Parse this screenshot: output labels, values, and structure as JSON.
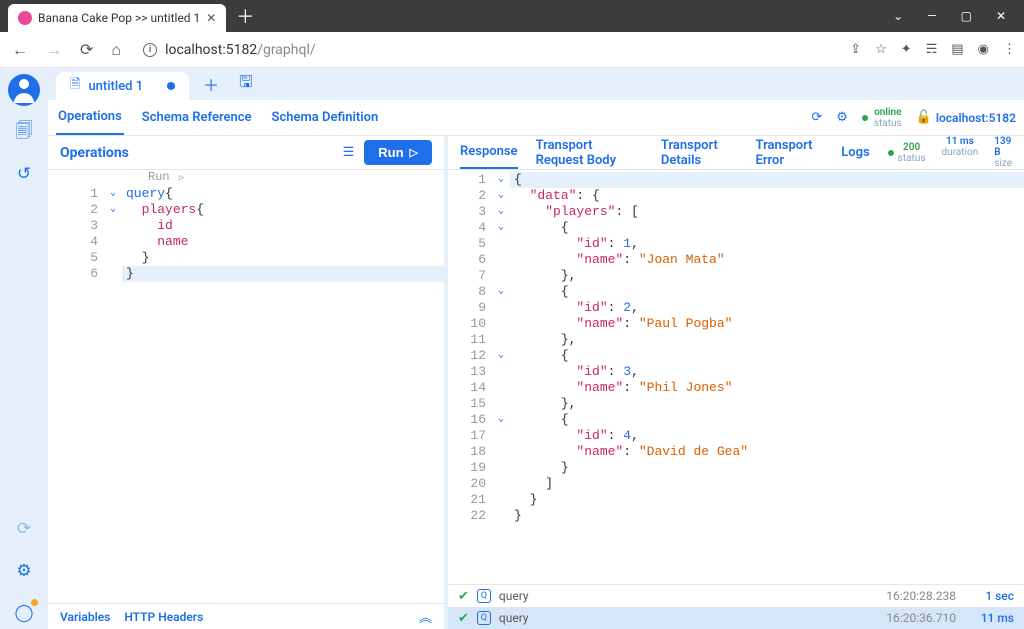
{
  "browser": {
    "tab_title": "Banana Cake Pop >> untitled 1",
    "url_host": "localhost:5182",
    "url_path": "/graphql/"
  },
  "doc_tabs": {
    "active": "untitled 1"
  },
  "tool_tabs": {
    "operations": "Operations",
    "schema_reference": "Schema Reference",
    "schema_definition": "Schema Definition"
  },
  "top_status": {
    "online_label": "online",
    "status_label": "status",
    "host": "localhost:5182"
  },
  "ops_panel": {
    "title": "Operations",
    "run_label": "Run",
    "codelens": "Run"
  },
  "query_lines": [
    {
      "n": 1,
      "fold": "v",
      "html": "<span class='tk-kw'>query</span><span class='tk-brace'>{</span>"
    },
    {
      "n": 2,
      "fold": "v",
      "html": "  <span class='tk-field'>players</span><span class='tk-brace'>{</span>"
    },
    {
      "n": 3,
      "fold": "",
      "html": "    <span class='tk-field'>id</span>"
    },
    {
      "n": 4,
      "fold": "",
      "html": "    <span class='tk-field'>name</span>"
    },
    {
      "n": 5,
      "fold": "",
      "html": "  <span class='tk-brace'>}</span>"
    },
    {
      "n": 6,
      "fold": "",
      "html": "<span class='tk-brace'>}</span>",
      "hl": true
    }
  ],
  "resp_tabs": {
    "response": "Response",
    "transport_request_body": "Transport Request Body",
    "transport_details": "Transport Details",
    "transport_error": "Transport Error",
    "logs": "Logs"
  },
  "resp_stats": {
    "status_value": "200",
    "status_label": "status",
    "duration_value": "11 ms",
    "duration_label": "duration",
    "size_value": "139 B",
    "size_label": "size"
  },
  "response_lines": [
    {
      "n": 1,
      "fold": "v",
      "html": "<span class='tk-punct'>{</span>",
      "hl": true
    },
    {
      "n": 2,
      "fold": "v",
      "html": "  <span class='tk-key'>\"data\"</span><span class='tk-punct'>: {</span>"
    },
    {
      "n": 3,
      "fold": "v",
      "html": "    <span class='tk-key'>\"players\"</span><span class='tk-punct'>: [</span>"
    },
    {
      "n": 4,
      "fold": "v",
      "html": "      <span class='tk-punct'>{</span>"
    },
    {
      "n": 5,
      "fold": "",
      "html": "        <span class='tk-key'>\"id\"</span><span class='tk-punct'>: </span><span class='tk-num'>1</span><span class='tk-punct'>,</span>"
    },
    {
      "n": 6,
      "fold": "",
      "html": "        <span class='tk-key'>\"name\"</span><span class='tk-punct'>: </span><span class='tk-str'>\"Joan Mata\"</span>"
    },
    {
      "n": 7,
      "fold": "",
      "html": "      <span class='tk-punct'>},</span>"
    },
    {
      "n": 8,
      "fold": "v",
      "html": "      <span class='tk-punct'>{</span>"
    },
    {
      "n": 9,
      "fold": "",
      "html": "        <span class='tk-key'>\"id\"</span><span class='tk-punct'>: </span><span class='tk-num'>2</span><span class='tk-punct'>,</span>"
    },
    {
      "n": 10,
      "fold": "",
      "html": "        <span class='tk-key'>\"name\"</span><span class='tk-punct'>: </span><span class='tk-str'>\"Paul Pogba\"</span>"
    },
    {
      "n": 11,
      "fold": "",
      "html": "      <span class='tk-punct'>},</span>"
    },
    {
      "n": 12,
      "fold": "v",
      "html": "      <span class='tk-punct'>{</span>"
    },
    {
      "n": 13,
      "fold": "",
      "html": "        <span class='tk-key'>\"id\"</span><span class='tk-punct'>: </span><span class='tk-num'>3</span><span class='tk-punct'>,</span>"
    },
    {
      "n": 14,
      "fold": "",
      "html": "        <span class='tk-key'>\"name\"</span><span class='tk-punct'>: </span><span class='tk-str'>\"Phil Jones\"</span>"
    },
    {
      "n": 15,
      "fold": "",
      "html": "      <span class='tk-punct'>},</span>"
    },
    {
      "n": 16,
      "fold": "v",
      "html": "      <span class='tk-punct'>{</span>"
    },
    {
      "n": 17,
      "fold": "",
      "html": "        <span class='tk-key'>\"id\"</span><span class='tk-punct'>: </span><span class='tk-num'>4</span><span class='tk-punct'>,</span>"
    },
    {
      "n": 18,
      "fold": "",
      "html": "        <span class='tk-key'>\"name\"</span><span class='tk-punct'>: </span><span class='tk-str'>\"David de Gea\"</span>"
    },
    {
      "n": 19,
      "fold": "",
      "html": "      <span class='tk-punct'>}</span>"
    },
    {
      "n": 20,
      "fold": "",
      "html": "    <span class='tk-punct'>]</span>"
    },
    {
      "n": 21,
      "fold": "",
      "html": "  <span class='tk-punct'>}</span>"
    },
    {
      "n": 22,
      "fold": "",
      "html": "<span class='tk-punct'>}</span>"
    }
  ],
  "history": [
    {
      "name": "query",
      "ts": "16:20:28.238",
      "dur": "1 sec",
      "active": false
    },
    {
      "name": "query",
      "ts": "16:20:36.710",
      "dur": "11 ms",
      "active": true
    }
  ],
  "left_bottom": {
    "variables": "Variables",
    "http_headers": "HTTP Headers"
  }
}
